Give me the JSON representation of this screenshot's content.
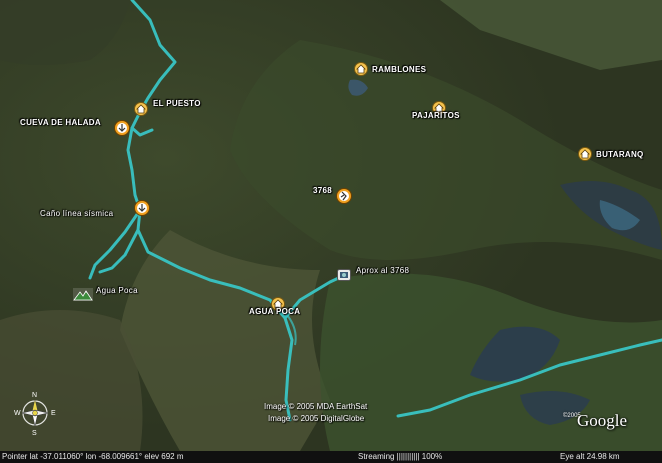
{
  "places": [
    {
      "id": "ramblones",
      "label": "RAMBLONES",
      "icon": "house-icon"
    },
    {
      "id": "el-puesto",
      "label": "EL PUESTO",
      "icon": "house-icon"
    },
    {
      "id": "pajaritos",
      "label": "PAJARITOS",
      "icon": "house-icon"
    },
    {
      "id": "butaranq",
      "label": "BUTARANQ",
      "icon": "house-icon"
    },
    {
      "id": "cueva-de-halada",
      "label": "CUEVA DE HALADA",
      "icon": "arrow-down-circle-icon"
    },
    {
      "id": "3768",
      "label": "3768",
      "icon": "hiker-icon"
    },
    {
      "id": "cano-linea-sismica",
      "label": "Caño línea sísmica",
      "icon": "arrow-down-circle-icon"
    },
    {
      "id": "aprox-al-3768",
      "label": "Aprox al 3768",
      "icon": "camera-icon"
    },
    {
      "id": "agua-poca-mountain",
      "label": "Agua Poca",
      "icon": "mountain-icon"
    },
    {
      "id": "agua-poca-town",
      "label": "AGUA POCA",
      "icon": "house-icon"
    }
  ],
  "copyright": {
    "line1": "Image © 2005 MDA EarthSat",
    "line2": "Image © 2005 DigitalGlobe",
    "google_small": "©2005",
    "google_logo": "Google"
  },
  "compass": {
    "n": "N",
    "s": "S",
    "e": "E",
    "w": "W"
  },
  "status": {
    "pointer": "Pointer  lat  -37.011060°   lon  -68.009661°  elev  692 m",
    "streaming": "Streaming ||||||||||| 100%",
    "eye_alt": "Eye  alt    24.98 km"
  },
  "colors": {
    "route": "#39c4c4",
    "status_bg": "#101010"
  }
}
